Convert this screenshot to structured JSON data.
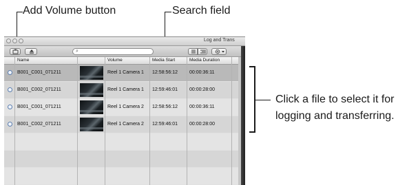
{
  "callouts": {
    "add_volume": "Add Volume button",
    "search_field": "Search field",
    "note_line1": "Click a file to select it for",
    "note_line2": "logging and transferring."
  },
  "window": {
    "title": "Log and Trans",
    "search": {
      "icon": "magnifier-icon",
      "value": ""
    }
  },
  "table": {
    "headers": [
      "Name",
      "Volume",
      "Media Start",
      "Media Duration"
    ],
    "rows": [
      {
        "name": "B001_C001_071211",
        "volume": "Reel 1 Camera 1",
        "start": "12:58:56:12",
        "duration": "00:00:36:11"
      },
      {
        "name": "B001_C002_071211",
        "volume": "Reel 1 Camera 1",
        "start": "12:59:46:01",
        "duration": "00:00:28:00"
      },
      {
        "name": "B001_C001_071211",
        "volume": "Reel 1 Camera 2",
        "start": "12:58:56:12",
        "duration": "00:00:36:11"
      },
      {
        "name": "B001_C002_071211",
        "volume": "Reel 1 Camera 2",
        "start": "12:59:46:01",
        "duration": "00:00:28:00"
      }
    ]
  }
}
